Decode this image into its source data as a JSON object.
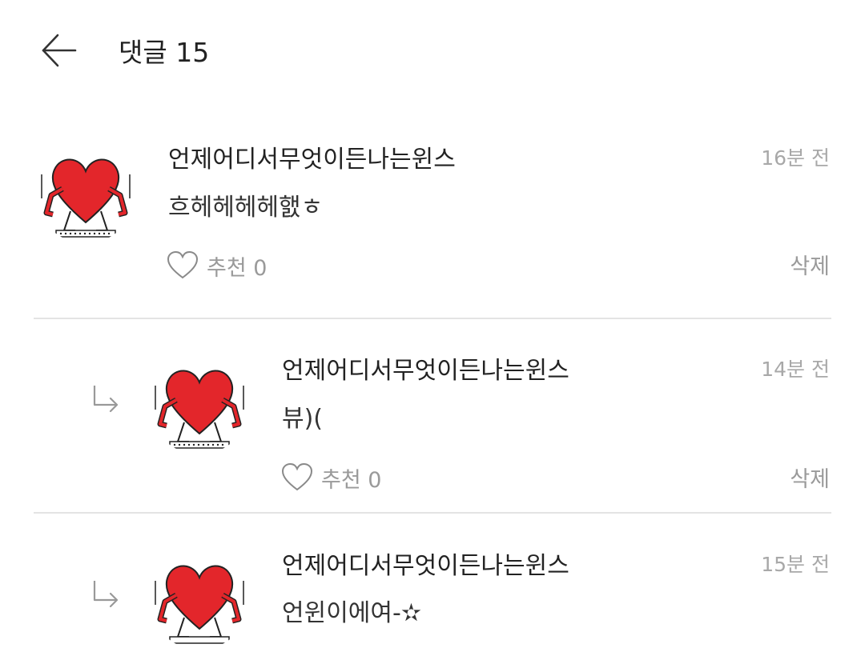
{
  "header": {
    "back_icon": "arrow-left-icon",
    "title": "댓글 15"
  },
  "comments": [
    {
      "author": "언제어디서무엇이든나는윈스",
      "time": "16분 전",
      "text": "흐헤헤헤헤햀ㅎ",
      "like_label": "추천 0",
      "like_count": 0,
      "delete_label": "삭제",
      "is_reply": false
    },
    {
      "author": "언제어디서무엇이든나는윈스",
      "time": "14분 전",
      "text": "뷰)(",
      "like_label": "추천 0",
      "like_count": 0,
      "delete_label": "삭제",
      "is_reply": true
    },
    {
      "author": "언제어디서무엇이든나는윈스",
      "time": "15분 전",
      "text": "언윈이에여-✫",
      "is_reply": true
    }
  ],
  "colors": {
    "heart_red": "#e3262b",
    "meta_gray": "#a8a8a8",
    "divider": "#e4e4e4"
  }
}
